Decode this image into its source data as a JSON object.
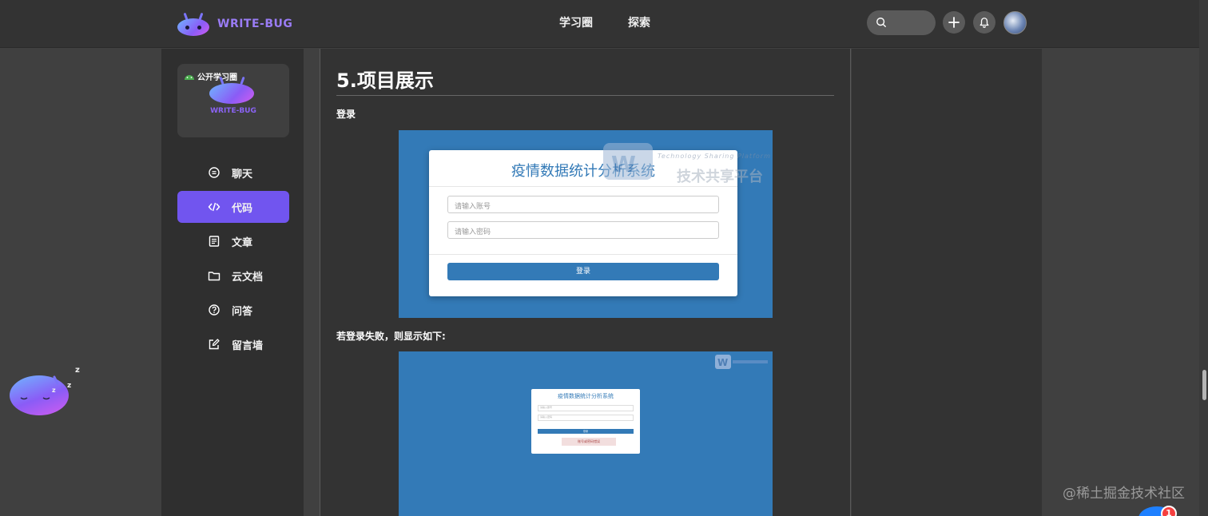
{
  "header": {
    "logo_text": "WRITE-BUG",
    "nav": [
      "学习圈",
      "探索"
    ],
    "icons": [
      "search-icon",
      "plus-icon",
      "bell-icon",
      "avatar"
    ]
  },
  "sidebar": {
    "circle_tag": "公开学习圈",
    "card_logo_text": "WRITE-BUG",
    "items": [
      {
        "label": "聊天",
        "icon": "chat-icon",
        "active": false
      },
      {
        "label": "代码",
        "icon": "code-icon",
        "active": true
      },
      {
        "label": "文章",
        "icon": "article-icon",
        "active": false
      },
      {
        "label": "云文档",
        "icon": "folder-icon",
        "active": false
      },
      {
        "label": "问答",
        "icon": "question-icon",
        "active": false
      },
      {
        "label": "留言墙",
        "icon": "edit-icon",
        "active": false
      }
    ]
  },
  "content": {
    "section_title": "5.项目展示",
    "login_label": "登录",
    "fail_label": "若登录失败，则显示如下:",
    "screenshot1": {
      "title": "疫情数据统计分析系统",
      "account_placeholder": "请输入账号",
      "password_placeholder": "请输入密码",
      "login_button": "登录",
      "watermark_en": "Technology Sharing Platform",
      "watermark_cn": "技术共享平台"
    },
    "screenshot2": {
      "title": "疫情数据统计分析系统",
      "account_placeholder": "请输入账号",
      "password_placeholder": "请输入密码",
      "login_button": "登录",
      "error_text": "账号或密码错误"
    }
  },
  "footer": {
    "watermark": "@稀土掘金技术社区",
    "badge_count": "1"
  },
  "colors": {
    "accent": "#7155ef",
    "screenshot_blue": "#337ab7"
  }
}
